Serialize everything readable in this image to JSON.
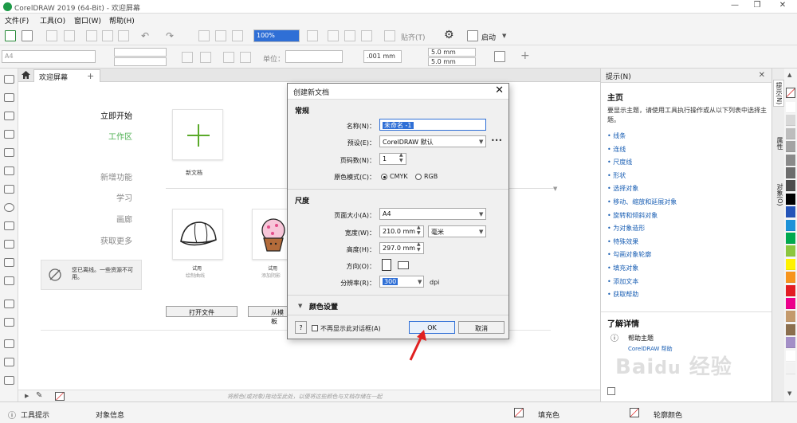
{
  "window": {
    "title": "CorelDRAW 2019 (64-Bit) - 欢迎屏幕",
    "minimize": "—",
    "restore": "❐",
    "close": "✕"
  },
  "menu": [
    "文件(F)",
    "工具(O)",
    "窗口(W)",
    "帮助(H)"
  ],
  "toolbar": {
    "zoom_value": "100%",
    "paste_label": "贴齐(T)",
    "launch_label": "启动",
    "page_size": "A4",
    "units_label": "单位：",
    "nudge": ".001 mm",
    "dup_x": "5.0 mm",
    "dup_y": "5.0 mm"
  },
  "tabs": {
    "welcome": "欢迎屏幕"
  },
  "welcome": {
    "nav": [
      "立即开始",
      "工作区",
      "新增功能",
      "学习",
      "画廊",
      "获取更多"
    ],
    "new_doc_label": "新文档",
    "offline_text": "您已离线。一些资源不可用。",
    "trial1_title": "试用",
    "trial1_sub": "绘制曲线",
    "trial2_title": "试用",
    "trial2_sub": "添加阴影",
    "open_file": "打开文件",
    "from_template": "从模板",
    "status_hint": "将颜色(或对象)拖动至此处，以便将这些颜色与文档存储在一起"
  },
  "dialog": {
    "title": "创建新文档",
    "section_general": "常规",
    "name_label": "名称(N)：",
    "name_value": "未命名 -1",
    "preset_label": "预设(E)：",
    "preset_value": "CorelDRAW 默认",
    "preset_more": "•••",
    "pages_label": "页码数(N)：",
    "pages_value": "1",
    "colormode_label": "原色模式(C)：",
    "cmyk": "CMYK",
    "rgb": "RGB",
    "section_size": "尺度",
    "pagesize_label": "页面大小(A)：",
    "pagesize_value": "A4",
    "width_label": "宽度(W)：",
    "width_value": "210.0 mm",
    "unit_value": "毫米",
    "height_label": "高度(H)：",
    "height_value": "297.0 mm",
    "orient_label": "方向(O)：",
    "res_label": "分辨率(R)：",
    "res_value": "300",
    "res_unit": "dpi",
    "color_settings": "颜色设置",
    "help_btn": "?",
    "dontshow": "不再显示此对话框(A)",
    "ok": "OK",
    "cancel": "取消"
  },
  "docker": {
    "header": "提示(N)",
    "main_title": "主页",
    "intro": "要显示主题，请使用工具执行操作或从以下列表中选择主题。",
    "links": [
      "线条",
      "连线",
      "尺度线",
      "形状",
      "选择对象",
      "移动、缩放和延展对象",
      "旋转和倾斜对象",
      "为对象造形",
      "特殊效果",
      "勾画对象轮廓",
      "填充对象",
      "添加文本",
      "获取帮助"
    ],
    "learn_more": "了解详情",
    "help_topic": "帮助主题",
    "help_sub": "CorelDRAW 帮助"
  },
  "vtabs": [
    "提示(N)",
    "属性",
    "对象(O)"
  ],
  "palette_colors": [
    "#ffffff",
    "#d8d8d8",
    "#bdbdbd",
    "#a3a3a3",
    "#8a8a8a",
    "#6d6d6d",
    "#4d4d4d",
    "#000000",
    "#2454b8",
    "#1d92d8",
    "#00a94f",
    "#8cc63f",
    "#fff200",
    "#f7941d",
    "#e31c23",
    "#ec008c",
    "#c49a6c",
    "#8b6f4e",
    "#a38fc7",
    "#ffffff",
    "#f2f2f2"
  ],
  "statusbar": {
    "tool_hint": "工具提示",
    "object_info": "对象信息",
    "fill": "填充色",
    "outline": "轮廓颜色"
  },
  "watermark": "Bai du 经验 jingyan.baidu.com"
}
